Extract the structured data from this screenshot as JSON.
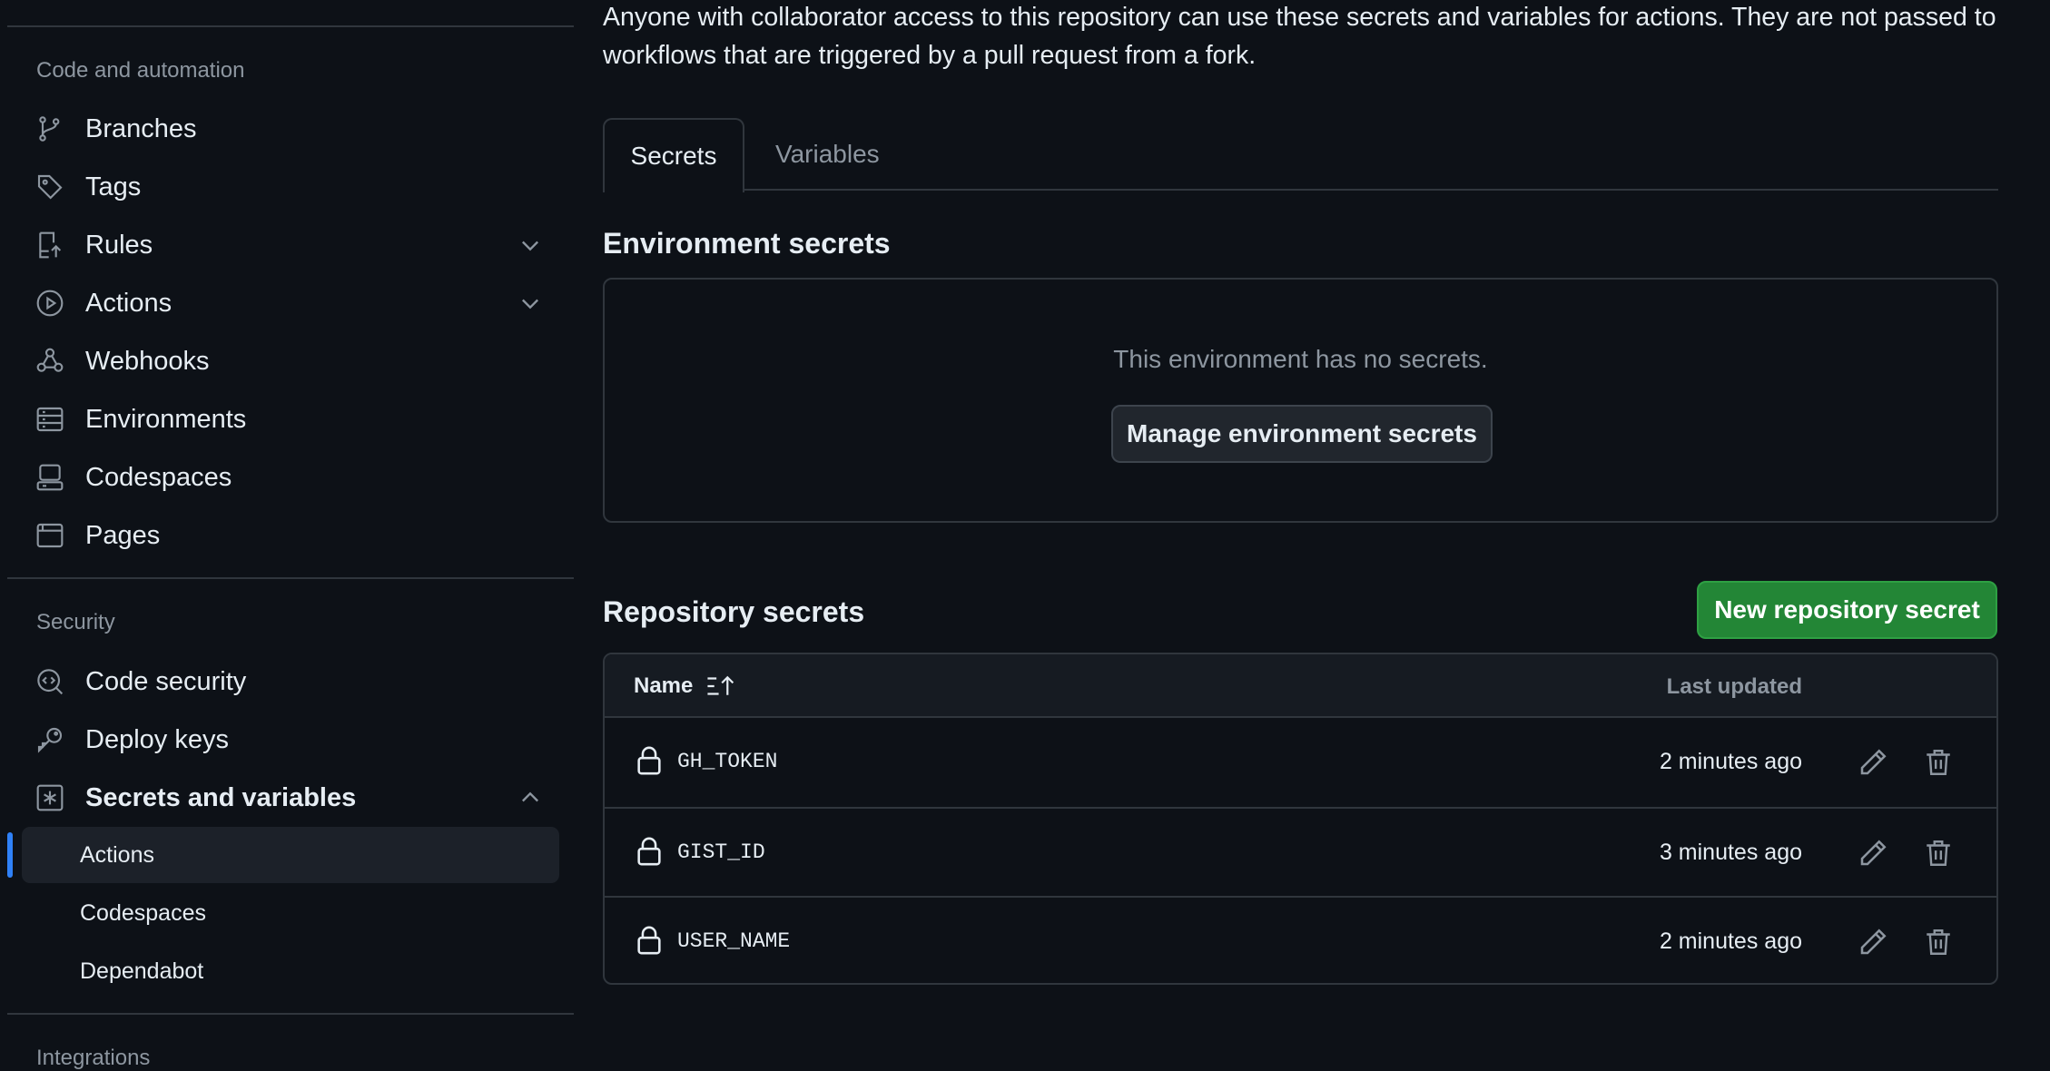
{
  "intro_text": "Anyone with collaborator access to this repository can use these secrets and variables for actions. They are not passed to workflows that are triggered by a pull request from a fork.",
  "sidebar": {
    "section_code": "Code and automation",
    "code_items": [
      {
        "label": "Branches",
        "icon": "git-branch-icon"
      },
      {
        "label": "Tags",
        "icon": "tag-icon"
      },
      {
        "label": "Rules",
        "icon": "rules-icon",
        "expandable": true
      },
      {
        "label": "Actions",
        "icon": "play-icon",
        "expandable": true
      },
      {
        "label": "Webhooks",
        "icon": "webhook-icon"
      },
      {
        "label": "Environments",
        "icon": "server-icon"
      },
      {
        "label": "Codespaces",
        "icon": "codespaces-icon"
      },
      {
        "label": "Pages",
        "icon": "browser-icon"
      }
    ],
    "section_security": "Security",
    "security_items": [
      {
        "label": "Code security",
        "icon": "code-security-icon"
      },
      {
        "label": "Deploy keys",
        "icon": "key-icon"
      },
      {
        "label": "Secrets and variables",
        "icon": "asterisk-icon",
        "expanded": true
      }
    ],
    "secrets_subitems": [
      {
        "label": "Actions",
        "active": true
      },
      {
        "label": "Codespaces"
      },
      {
        "label": "Dependabot"
      }
    ],
    "section_integrations": "Integrations"
  },
  "tabs": [
    {
      "label": "Secrets",
      "selected": true
    },
    {
      "label": "Variables",
      "selected": false
    }
  ],
  "environment": {
    "heading": "Environment secrets",
    "empty_text": "This environment has no secrets.",
    "manage_button": "Manage environment secrets"
  },
  "repository": {
    "heading": "Repository secrets",
    "new_button": "New repository secret",
    "col_name": "Name",
    "col_updated": "Last updated",
    "secrets": [
      {
        "name": "GH_TOKEN",
        "updated": "2 minutes ago"
      },
      {
        "name": "GIST_ID",
        "updated": "3 minutes ago"
      },
      {
        "name": "USER_NAME",
        "updated": "2 minutes ago"
      }
    ]
  },
  "colors": {
    "background": "#0d1117",
    "border": "#30363d",
    "muted": "#8d96a0",
    "accent": "#2f81f7",
    "primary_button": "#238636"
  }
}
